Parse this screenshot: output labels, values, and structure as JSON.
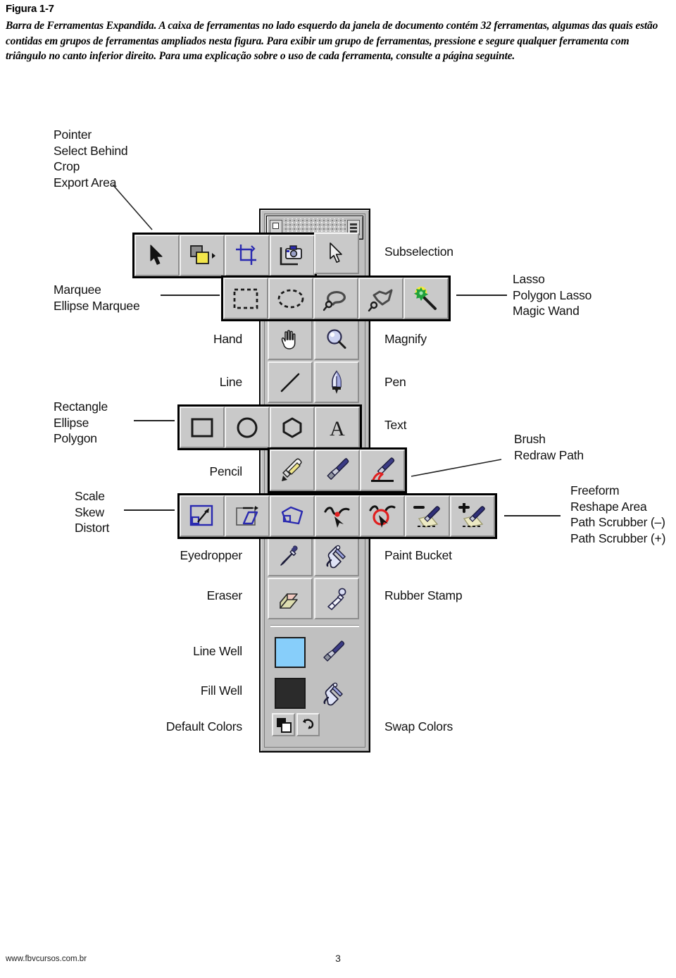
{
  "figure": {
    "title": "Figura 1-7",
    "caption": "Barra de Ferramentas Expandida. A caixa de ferramentas no lado esquerdo da janela de documento contém 32 ferramentas, algumas das quais estão contidas em grupos de ferramentas ampliados nesta figura. Para exibir um grupo de ferramentas, pressione e segure qualquer ferramenta com triângulo no canto inferior direito. Para uma explicação sobre o uso de cada ferramenta, consulte a página seguinte."
  },
  "labels": {
    "select_group": "Pointer\nSelect Behind\nCrop\nExport Area",
    "subselection": "Subselection",
    "marquee_group": "Marquee\nEllipse Marquee",
    "lasso_group": "Lasso\nPolygon Lasso\nMagic Wand",
    "hand": "Hand",
    "magnify": "Magnify",
    "line": "Line",
    "pen": "Pen",
    "shape_group": "Rectangle\nEllipse\nPolygon",
    "text": "Text",
    "brush_group": "Brush\nRedraw Path",
    "pencil": "Pencil",
    "transform_group": "Scale\nSkew\nDistort",
    "path_group": "Freeform\nReshape Area\nPath Scrubber (–)\nPath Scrubber (+)",
    "eyedropper": "Eyedropper",
    "paint_bucket": "Paint Bucket",
    "eraser": "Eraser",
    "rubber_stamp": "Rubber Stamp",
    "line_well": "Line Well",
    "fill_well": "Fill Well",
    "default_colors": "Default Colors",
    "swap_colors": "Swap Colors"
  },
  "toolbox": {
    "tools": [
      {
        "id": "pointer",
        "name": "Pointer",
        "icon": "pointer-arrow-icon"
      },
      {
        "id": "select-behind",
        "name": "Select Behind",
        "icon": "select-behind-icon"
      },
      {
        "id": "crop",
        "name": "Crop",
        "icon": "crop-icon"
      },
      {
        "id": "export-area",
        "name": "Export Area",
        "icon": "export-area-camera-icon"
      },
      {
        "id": "subselection",
        "name": "Subselection",
        "icon": "subselection-arrow-icon"
      },
      {
        "id": "marquee",
        "name": "Marquee",
        "icon": "marquee-rect-icon"
      },
      {
        "id": "ellipse-marquee",
        "name": "Ellipse Marquee",
        "icon": "marquee-ellipse-icon"
      },
      {
        "id": "lasso",
        "name": "Lasso",
        "icon": "lasso-icon"
      },
      {
        "id": "polygon-lasso",
        "name": "Polygon Lasso",
        "icon": "polygon-lasso-icon"
      },
      {
        "id": "magic-wand",
        "name": "Magic Wand",
        "icon": "magic-wand-icon"
      },
      {
        "id": "hand",
        "name": "Hand",
        "icon": "hand-icon"
      },
      {
        "id": "magnify",
        "name": "Magnify",
        "icon": "magnifier-icon"
      },
      {
        "id": "line",
        "name": "Line",
        "icon": "line-icon"
      },
      {
        "id": "pen",
        "name": "Pen",
        "icon": "pen-nib-icon"
      },
      {
        "id": "rectangle",
        "name": "Rectangle",
        "icon": "rectangle-icon"
      },
      {
        "id": "ellipse",
        "name": "Ellipse",
        "icon": "ellipse-icon"
      },
      {
        "id": "polygon",
        "name": "Polygon",
        "icon": "polygon-icon"
      },
      {
        "id": "text",
        "name": "Text",
        "icon": "text-a-icon"
      },
      {
        "id": "pencil",
        "name": "Pencil",
        "icon": "pencil-icon"
      },
      {
        "id": "brush",
        "name": "Brush",
        "icon": "brush-icon"
      },
      {
        "id": "redraw-path",
        "name": "Redraw Path",
        "icon": "redraw-path-icon"
      },
      {
        "id": "scale",
        "name": "Scale",
        "icon": "scale-icon"
      },
      {
        "id": "skew",
        "name": "Skew",
        "icon": "skew-icon"
      },
      {
        "id": "distort",
        "name": "Distort",
        "icon": "distort-icon"
      },
      {
        "id": "freeform",
        "name": "Freeform",
        "icon": "freeform-icon"
      },
      {
        "id": "reshape-area",
        "name": "Reshape Area",
        "icon": "reshape-area-icon"
      },
      {
        "id": "path-scrubber-minus",
        "name": "Path Scrubber (–)",
        "icon": "path-scrubber-minus-icon"
      },
      {
        "id": "path-scrubber-plus",
        "name": "Path Scrubber (+)",
        "icon": "path-scrubber-plus-icon"
      },
      {
        "id": "eyedropper",
        "name": "Eyedropper",
        "icon": "eyedropper-icon"
      },
      {
        "id": "paint-bucket",
        "name": "Paint Bucket",
        "icon": "paint-bucket-icon"
      },
      {
        "id": "eraser",
        "name": "Eraser",
        "icon": "eraser-icon"
      },
      {
        "id": "rubber-stamp",
        "name": "Rubber Stamp",
        "icon": "rubber-stamp-icon"
      }
    ],
    "colors": {
      "line_well": "#87cefa",
      "fill_well": "#2b2b2b",
      "palette_face": "#c0c0c0",
      "cell_face": "#c9c9c9",
      "icon_blue": "#2a2ab0",
      "accent_red": "#e02020",
      "accent_yellow": "#f2e64b"
    }
  },
  "footer": {
    "url": "www.fbvcursos.com.br",
    "page": "3"
  }
}
